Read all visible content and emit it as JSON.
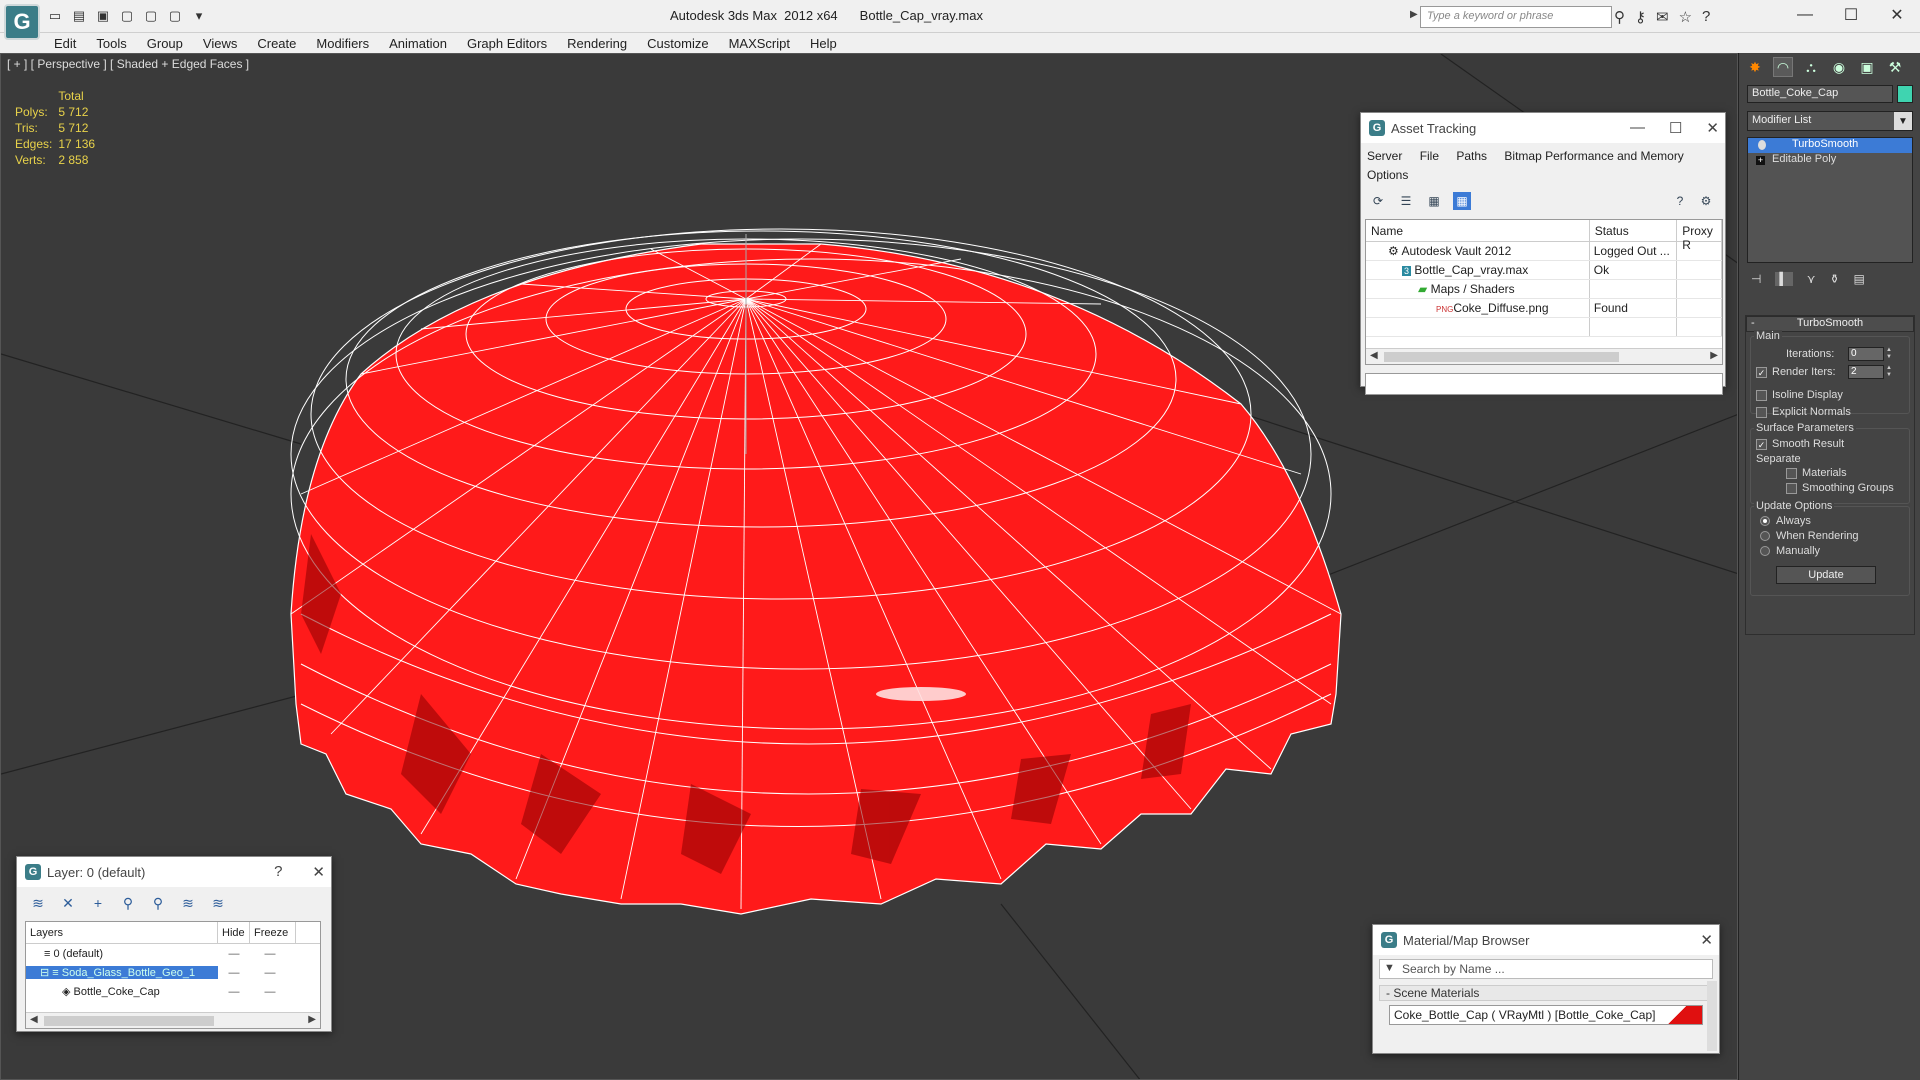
{
  "titlebar": {
    "app_title": "Autodesk 3ds Max  2012 x64",
    "file_name": "Bottle_Cap_vray.max",
    "search_placeholder": "Type a keyword or phrase"
  },
  "menu": [
    "Edit",
    "Tools",
    "Group",
    "Views",
    "Create",
    "Modifiers",
    "Animation",
    "Graph Editors",
    "Rendering",
    "Customize",
    "MAXScript",
    "Help"
  ],
  "viewport": {
    "label": "[ + ] [ Perspective ] [ Shaded + Edged Faces ]",
    "stats": {
      "header": "Total",
      "rows": [
        {
          "label": "Polys:",
          "value": "5 712"
        },
        {
          "label": "Tris:",
          "value": "5 712"
        },
        {
          "label": "Edges:",
          "value": "17 136"
        },
        {
          "label": "Verts:",
          "value": "2 858"
        }
      ]
    },
    "object_color": "#ff1a1a"
  },
  "asset_tracking": {
    "title": "Asset Tracking",
    "menus": [
      "Server",
      "File",
      "Paths",
      "Bitmap Performance and Memory"
    ],
    "menus_row2": [
      "Options"
    ],
    "columns": [
      "Name",
      "Status",
      "Proxy R"
    ],
    "rows": [
      {
        "name": "Autodesk Vault 2012",
        "status": "Logged Out ...",
        "indent": 1
      },
      {
        "name": "Bottle_Cap_vray.max",
        "status": "Ok",
        "indent": 2
      },
      {
        "name": "Maps / Shaders",
        "status": "",
        "indent": 3
      },
      {
        "name": "Coke_Diffuse.png",
        "status": "Found",
        "indent": 4
      },
      {
        "name": "",
        "status": "",
        "indent": 0
      }
    ]
  },
  "layer_dialog": {
    "title": "Layer: 0 (default)",
    "columns": [
      "Layers",
      "Hide",
      "Freeze"
    ],
    "rows": [
      {
        "name": "0 (default)",
        "selected": false
      },
      {
        "name": "Soda_Glass_Bottle_Geo_1",
        "selected": true
      },
      {
        "name": "Bottle_Coke_Cap",
        "selected": false
      }
    ]
  },
  "material_browser": {
    "title": "Material/Map Browser",
    "search_placeholder": "Search by Name ...",
    "group": "- Scene Materials",
    "material": "Coke_Bottle_Cap  ( VRayMtl ) [Bottle_Coke_Cap]"
  },
  "command_panel": {
    "object_name": "Bottle_Coke_Cap",
    "object_color": "#3fd4b0",
    "modifier_list": "Modifier List",
    "stack": [
      "TurboSmooth",
      "Editable Poly"
    ],
    "rollout_title": "TurboSmooth",
    "main_label": "Main",
    "iterations_label": "Iterations:",
    "iterations_value": "0",
    "render_iters_label": "Render Iters:",
    "render_iters_value": "2",
    "isoline_label": "Isoline Display",
    "explicit_normals_label": "Explicit Normals",
    "surface_params_label": "Surface Parameters",
    "smooth_result_label": "Smooth Result",
    "separate_label": "Separate",
    "materials_label": "Materials",
    "smoothing_groups_label": "Smoothing Groups",
    "update_options_label": "Update Options",
    "always_label": "Always",
    "when_rendering_label": "When Rendering",
    "manually_label": "Manually",
    "update_button": "Update"
  }
}
